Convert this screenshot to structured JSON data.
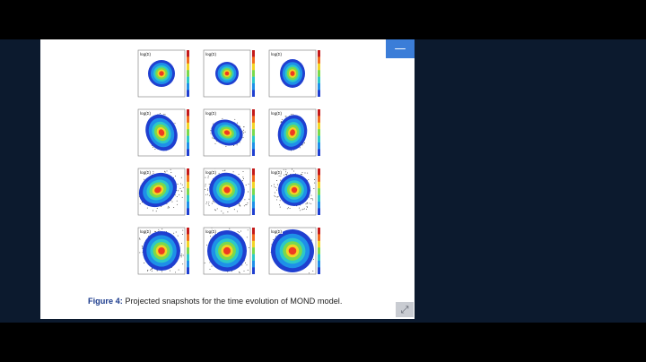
{
  "controls": {
    "minimize_glyph": "—",
    "expand_glyph": "⤢"
  },
  "figure": {
    "panel_label": "log(Σ)",
    "caption_label": "Figure 4:",
    "caption_text": " Projected snapshots for the time evolution of MOND model."
  },
  "colors": {
    "page_background": "#000000",
    "backdrop": "#0c1a2e",
    "slide": "#ffffff",
    "accent": "#3b7dd8",
    "caption_label": "#1a3a8c"
  },
  "icons": [
    "minimize-icon",
    "expand-icon"
  ]
}
